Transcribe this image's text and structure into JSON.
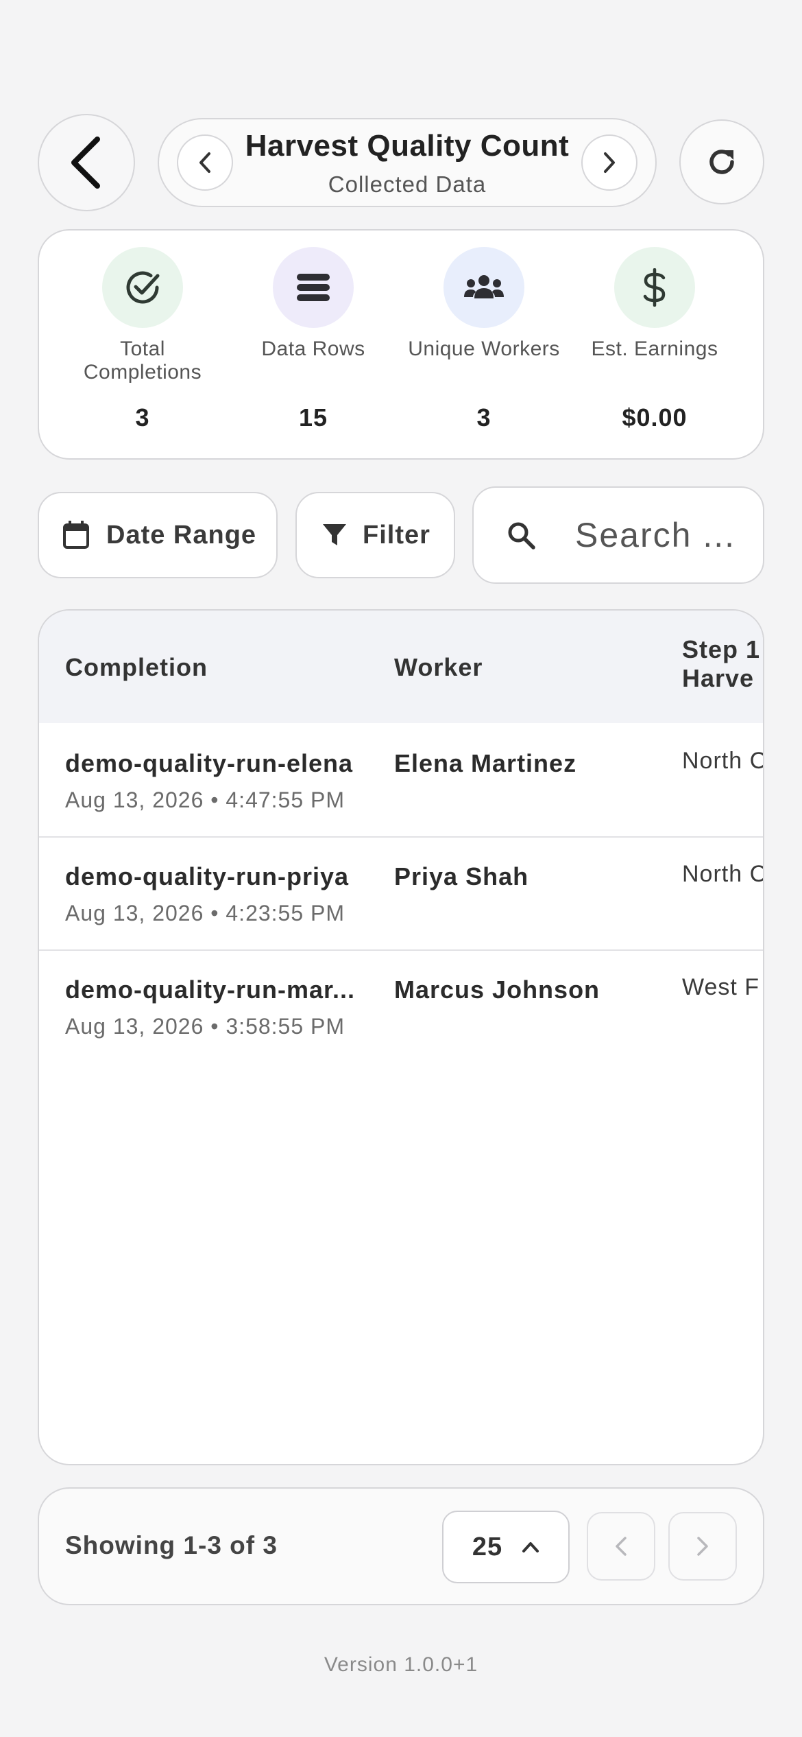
{
  "header": {
    "title": "Harvest Quality Count",
    "subtitle": "Collected Data",
    "back_icon": "chevron-left-icon",
    "refresh_icon": "refresh-icon"
  },
  "stats": [
    {
      "label": "Total Completions",
      "value": "3",
      "icon": "check-circle-icon",
      "bg": "#e9f5ec"
    },
    {
      "label": "Data Rows",
      "value": "15",
      "icon": "rows-icon",
      "bg": "#eeebfa"
    },
    {
      "label": "Unique Workers",
      "value": "3",
      "icon": "users-icon",
      "bg": "#e8eefc"
    },
    {
      "label": "Est. Earnings",
      "value": "$0.00",
      "icon": "dollar-icon",
      "bg": "#e9f5ec"
    }
  ],
  "toolbar": {
    "date_range_label": "Date Range",
    "filter_label": "Filter",
    "search_placeholder": "Search ..."
  },
  "table": {
    "columns": [
      "Completion",
      "Worker",
      "Step 1\nHarve"
    ],
    "rows": [
      {
        "id": "demo-quality-run-elena",
        "date": "Aug 13, 2026 • 4:47:55 PM",
        "worker": "Elena Martinez",
        "step": "North C"
      },
      {
        "id": "demo-quality-run-priya",
        "date": "Aug 13, 2026 • 4:23:55 PM",
        "worker": "Priya Shah",
        "step": "North C"
      },
      {
        "id": "demo-quality-run-mar...",
        "date": "Aug 13, 2026 • 3:58:55 PM",
        "worker": "Marcus Johnson",
        "step": "West F"
      }
    ]
  },
  "pager": {
    "showing": "Showing 1-3 of 3",
    "page_size": "25"
  },
  "footer": {
    "version": "Version 1.0.0+1"
  }
}
